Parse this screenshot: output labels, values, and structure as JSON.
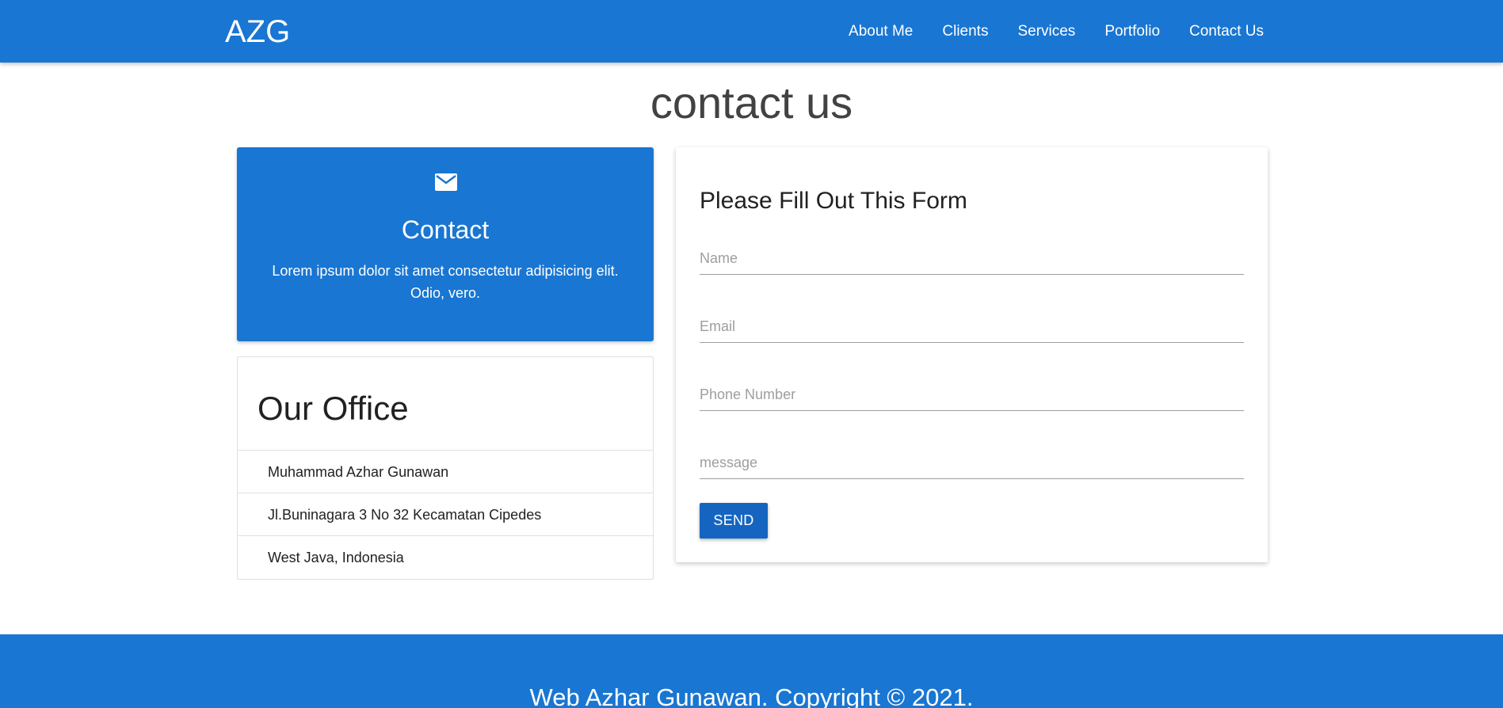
{
  "navbar": {
    "brand": "AZG",
    "links": [
      "About Me",
      "Clients",
      "Services",
      "Portfolio",
      "Contact Us"
    ]
  },
  "page": {
    "title": "contact us"
  },
  "contact_card": {
    "icon": "mail-icon",
    "title": "Contact",
    "text": "Lorem ipsum dolor sit amet consectetur adipisicing elit. Odio, vero."
  },
  "office": {
    "title": "Our Office",
    "items": [
      "Muhammad Azhar Gunawan",
      "Jl.Buninagara 3 No 32 Kecamatan Cipedes",
      "West Java, Indonesia"
    ]
  },
  "form": {
    "title": "Please Fill Out This Form",
    "name_placeholder": "Name",
    "email_placeholder": "Email",
    "phone_placeholder": "Phone Number",
    "message_placeholder": "message",
    "send_label": "SEND"
  },
  "footer": {
    "text": "Web Azhar Gunawan. Copyright © 2021."
  },
  "colors": {
    "primary": "#1976d2",
    "button": "#1565c0"
  }
}
